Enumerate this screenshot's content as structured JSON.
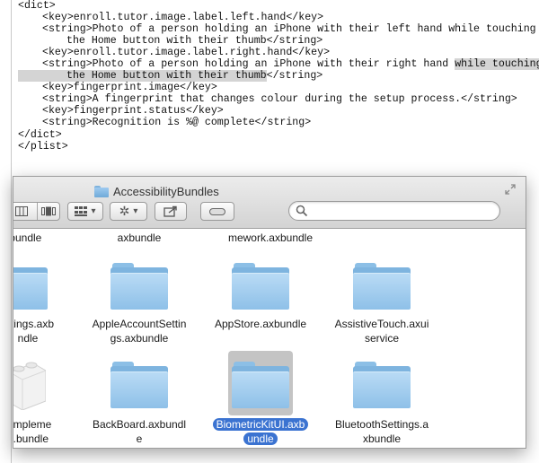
{
  "editor": {
    "lines": [
      {
        "text": "<dict>",
        "indent": 0
      },
      {
        "text": "<key>enroll.tutor.image.label.left.hand</key>",
        "indent": 1
      },
      {
        "text": "<string>Photo of a person holding an iPhone with their left hand while touching",
        "indent": 1
      },
      {
        "text": "the Home button with their thumb</string>",
        "indent": 2
      },
      {
        "text": "<key>enroll.tutor.image.label.right.hand</key>",
        "indent": 1
      },
      {
        "text_before": "<string>Photo of a person holding an iPhone with their right hand ",
        "text_hl": "while touching",
        "indent": 1
      },
      {
        "text_hl": "the Home button with their thumb",
        "text_after": "</string>",
        "indent": 2
      },
      {
        "text": "<key>fingerprint.image</key>",
        "indent": 1
      },
      {
        "text": "<string>A fingerprint that changes colour during the setup process.</string>",
        "indent": 1
      },
      {
        "text": "<key>fingerprint.status</key>",
        "indent": 1
      },
      {
        "text": "<string>Recognition is %@ complete</string>",
        "indent": 1
      },
      {
        "text": "</dict>",
        "indent": 0
      },
      {
        "text": "</plist>",
        "indent": 0
      }
    ]
  },
  "finder": {
    "title": "AccessibilityBundles",
    "search_placeholder": "",
    "rows": [
      [
        "r.bundle",
        "axbundle",
        "mework.axbundle",
        ""
      ],
      [
        "ettings.axb\nndle",
        "AppleAccountSettin\ngs.axbundle",
        "AppStore.axbundle",
        "AssistiveTouch.axui\nservice"
      ],
      [
        "hImpleme\nn.bundle",
        "BackBoard.axbundl\ne",
        "BiometricKitUI.axb\nundle",
        "BluetoothSettings.a\nxbundle"
      ]
    ],
    "items": {
      "r0c0": "r.bundle",
      "r0c1": "axbundle",
      "r0c2": "mework.axbundle",
      "r1c0a": "ettings.axb",
      "r1c0b": "ndle",
      "r1c1a": "AppleAccountSettin",
      "r1c1b": "gs.axbundle",
      "r1c2a": "AppStore.axbundle",
      "r1c3a": "AssistiveTouch.axui",
      "r1c3b": "service",
      "r2c0a": "hImpleme",
      "r2c0b": "n.bundle",
      "r2c1a": "BackBoard.axbundl",
      "r2c1b": "e",
      "r2c2a": "BiometricKitUI.axb",
      "r2c2b": "undle",
      "r2c3a": "BluetoothSettings.a",
      "r2c3b": "xbundle"
    },
    "selected_item": "BiometricKitUI.axbundle",
    "colors": {
      "selection": "#3b73d1",
      "folder": "#8ec0e8",
      "highlight": "#d4d4d4"
    },
    "icons": [
      "folder-icon",
      "search-icon",
      "icon-view-icon",
      "list-view-icon",
      "arrange-icon",
      "gear-icon",
      "share-icon",
      "tag-icon",
      "fullscreen-icon",
      "lego-brick-icon"
    ]
  }
}
